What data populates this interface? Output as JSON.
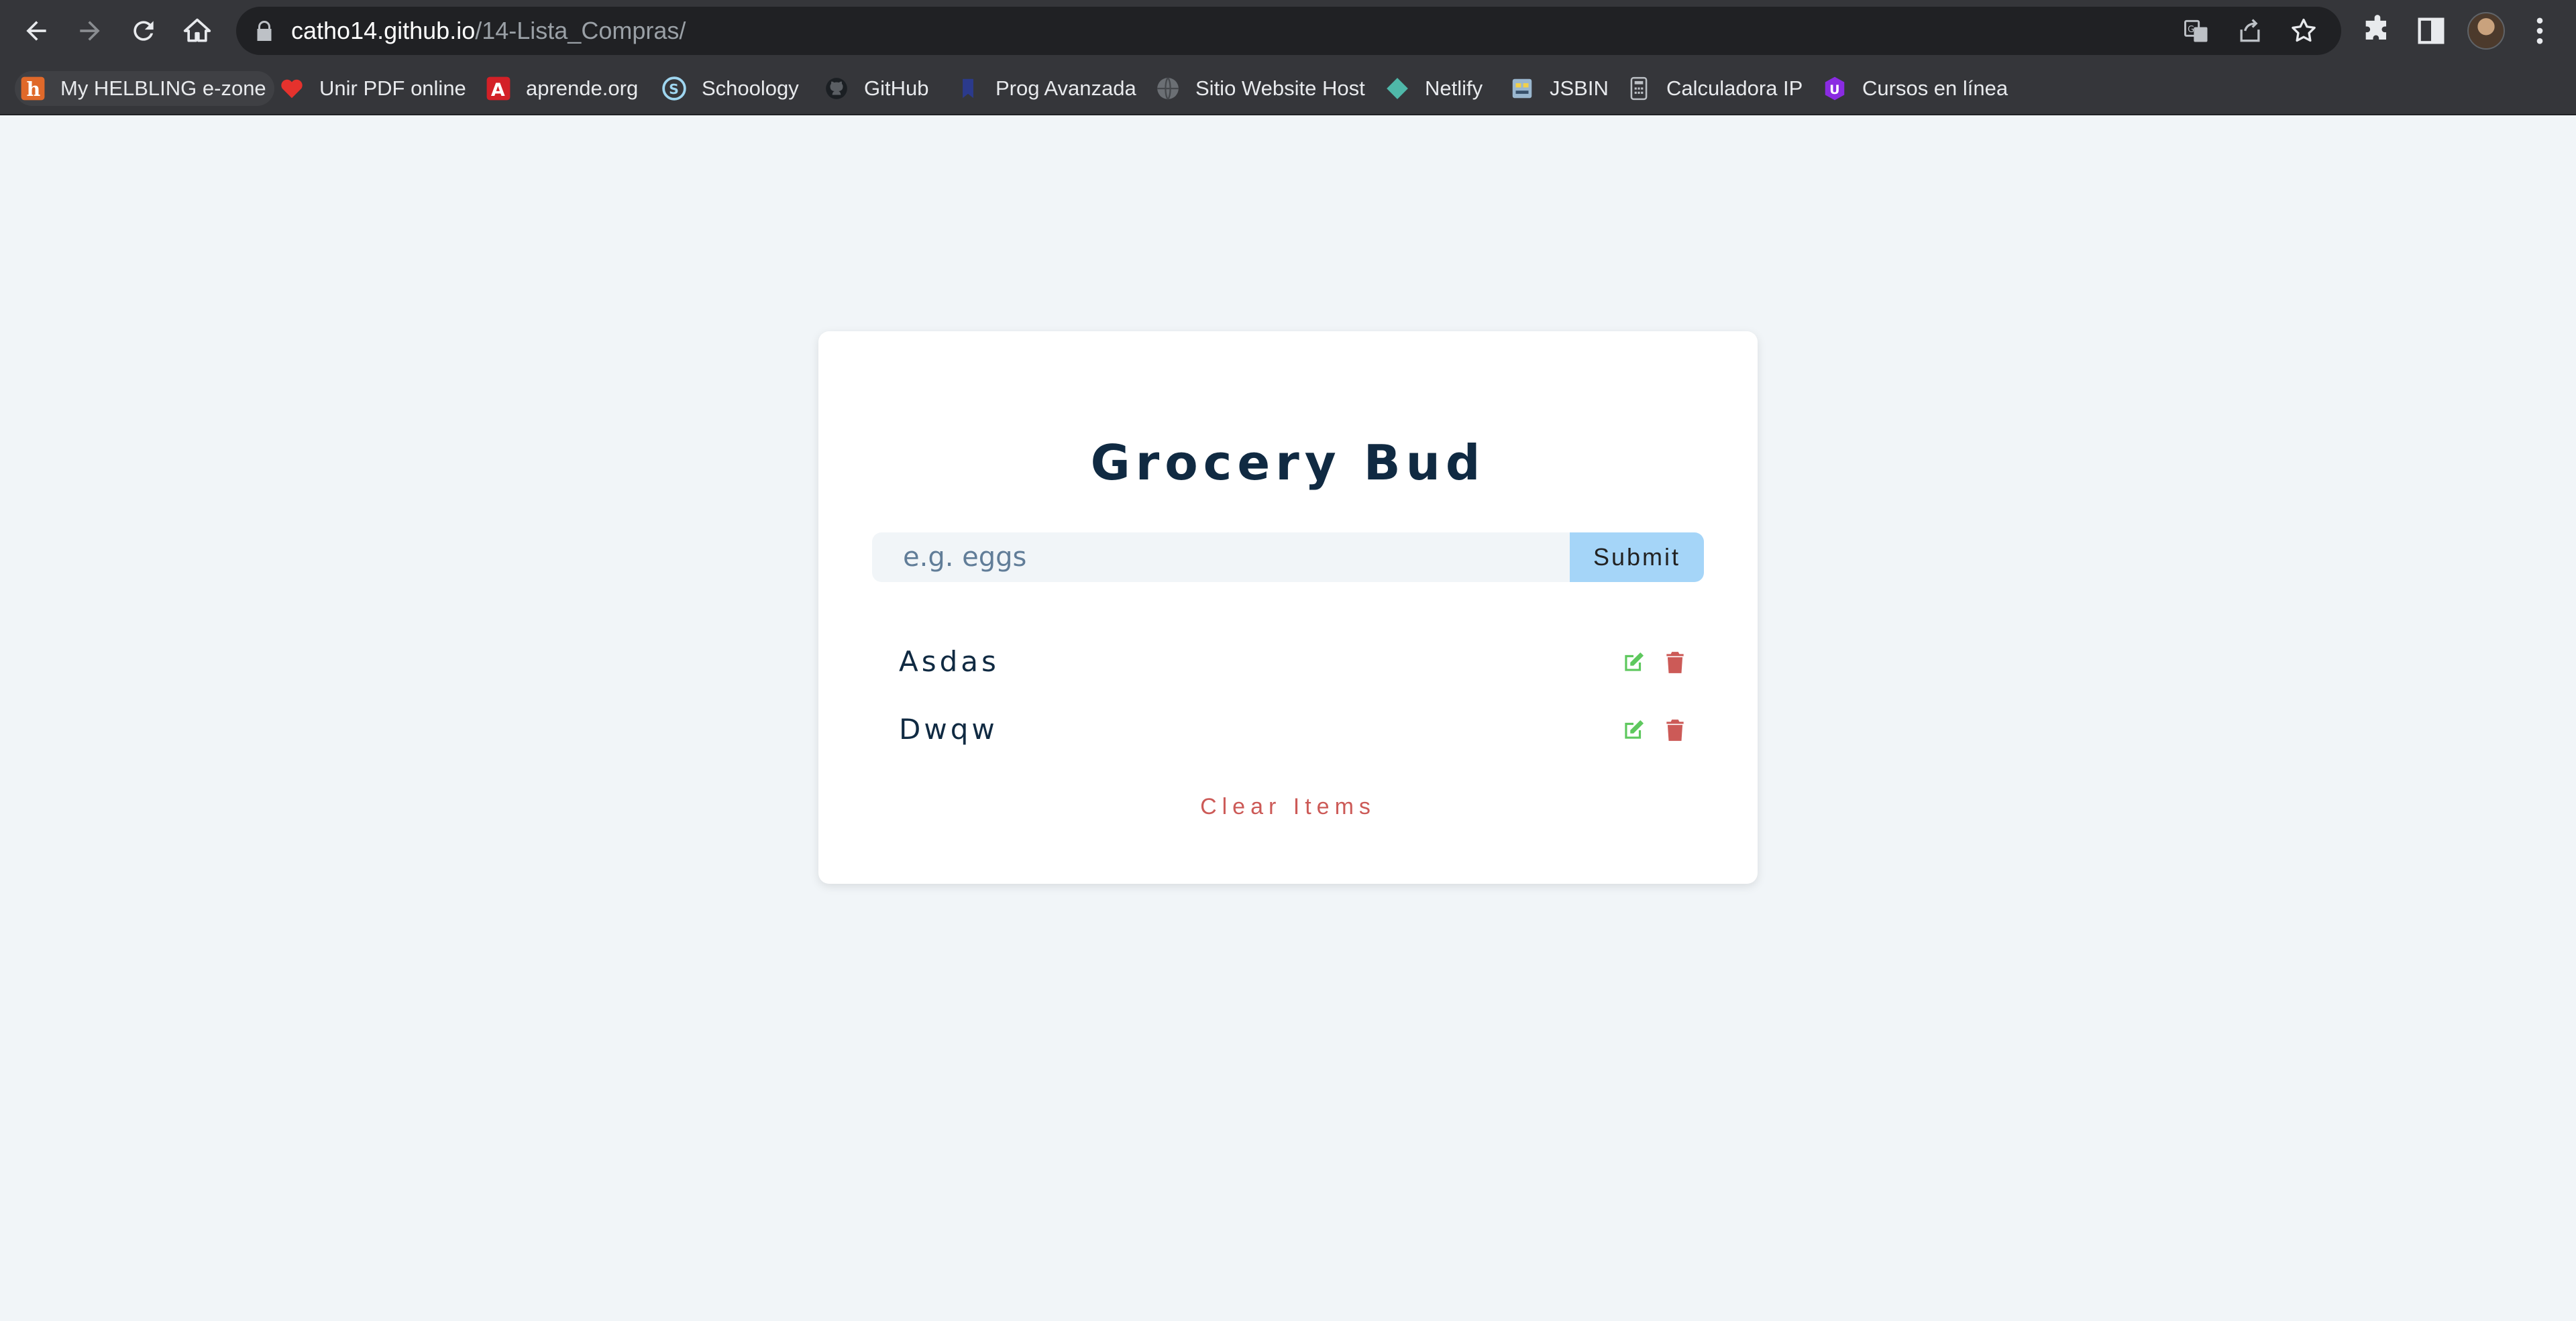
{
  "browser": {
    "url_host": "catho14.github.io",
    "url_path": "/14-Lista_Compras/",
    "bookmarks": [
      {
        "label": "My HELBLING e-zone",
        "icon": "helbling-icon"
      },
      {
        "label": "Unir PDF online",
        "icon": "heart-pdf-icon"
      },
      {
        "label": "aprende.org",
        "icon": "aprende-icon"
      },
      {
        "label": "Schoology",
        "icon": "schoology-icon"
      },
      {
        "label": "GitHub",
        "icon": "github-icon"
      },
      {
        "label": "Prog Avanzada",
        "icon": "bookmark-icon"
      },
      {
        "label": "Sitio Website Host",
        "icon": "globe-icon"
      },
      {
        "label": "Netlify",
        "icon": "netlify-icon"
      },
      {
        "label": "JSBIN",
        "icon": "jsbin-icon"
      },
      {
        "label": "Calculadora IP",
        "icon": "calculator-icon"
      },
      {
        "label": "Cursos en línea",
        "icon": "udemy-icon"
      }
    ]
  },
  "app": {
    "title": "Grocery Bud",
    "input_placeholder": "e.g. eggs",
    "input_value": "",
    "submit_label": "Submit",
    "items": [
      {
        "name": "Asdas"
      },
      {
        "name": "Dwqw"
      }
    ],
    "clear_label": "Clear Items",
    "colors": {
      "title": "#102a42",
      "submit_bg": "#a5d5f8",
      "edit": "#5ec85e",
      "delete": "#cc5a57",
      "clear": "#cc5a57",
      "page_bg": "#f1f5f8"
    }
  }
}
